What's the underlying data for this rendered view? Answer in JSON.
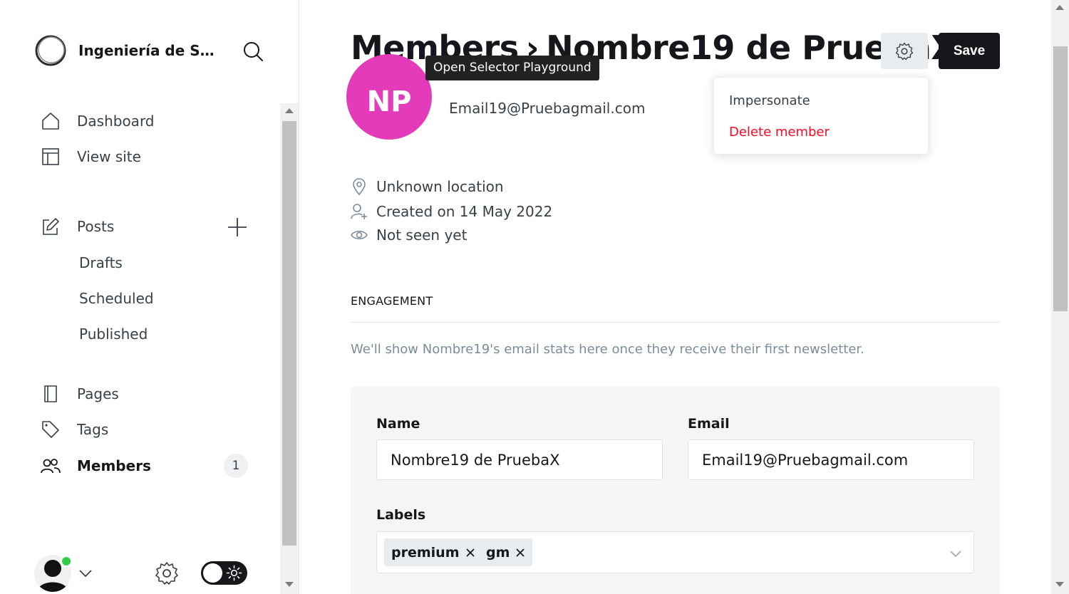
{
  "sidebar": {
    "brand_name": "Ingeniería de So...",
    "nav": {
      "dashboard": "Dashboard",
      "view_site": "View site",
      "posts": "Posts",
      "drafts": "Drafts",
      "scheduled": "Scheduled",
      "published": "Published",
      "pages": "Pages",
      "tags": "Tags",
      "members": "Members"
    },
    "members_count": "1"
  },
  "header": {
    "breadcrumb_root": "Members",
    "separator": "›",
    "member_name": "Nombre19 de PruebaX",
    "save_label": "Save"
  },
  "tooltip": "Open Selector Playground",
  "dropdown": {
    "impersonate": "Impersonate",
    "delete": "Delete member"
  },
  "member": {
    "initials": "NP",
    "email": "Email19@Pruebagmail.com",
    "location": "Unknown location",
    "created": "Created on 14 May 2022",
    "seen": "Not seen yet"
  },
  "engagement": {
    "heading": "ENGAGEMENT",
    "note": "We'll show Nombre19's email stats here once they receive their first newsletter."
  },
  "form": {
    "name_label": "Name",
    "name_value": "Nombre19 de PruebaX",
    "email_label": "Email",
    "email_value": "Email19@Pruebagmail.com",
    "labels_label": "Labels",
    "labels": [
      "premium",
      "gm"
    ]
  },
  "colors": {
    "accent_pink": "#e33bb9",
    "danger": "#f50b23",
    "online": "#30cf43",
    "dark": "#15171a"
  }
}
